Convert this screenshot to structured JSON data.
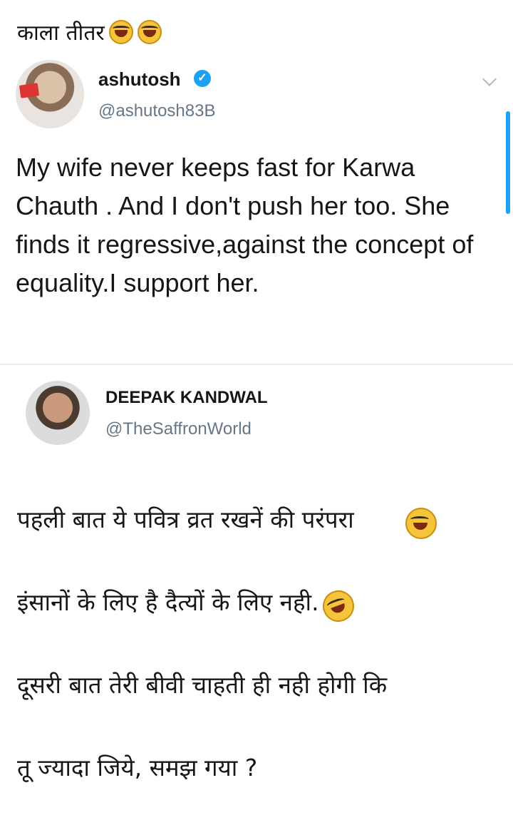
{
  "caption": {
    "text": "काला तीतर",
    "emoji": "laughing-tears-emoji"
  },
  "tweet_original": {
    "author_name": "ashutosh",
    "verified": true,
    "handle": "@ashutosh83B",
    "body": "My wife never keeps fast for Karwa Chauth . And I don't push her too. She finds it regressive,against the concept of equality.I support her."
  },
  "tweet_reply": {
    "author_name": "DEEPAK KANDWAL",
    "handle": "@TheSaffronWorld",
    "body_line1": "पहली बात ये पवित्र व्रत रखनें की परंपरा",
    "body_line2": "इंसानों के लिए है दैत्यों के लिए नही.",
    "body_line3": "दूसरी बात तेरी बीवी चाहती ही नही होगी कि",
    "body_line4": "तू ज्यादा जिये, समझ गया ?"
  },
  "colors": {
    "accent": "#1da1f2",
    "text": "#14171a",
    "muted": "#657786"
  }
}
